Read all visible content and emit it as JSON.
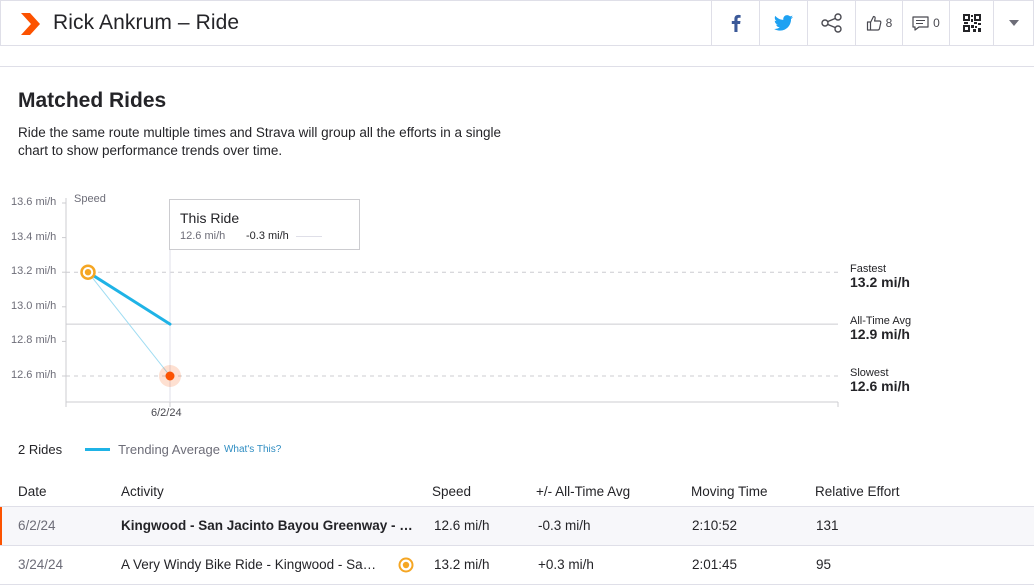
{
  "header": {
    "title": "Rick Ankrum – Ride",
    "kudos_count": "8",
    "comments_count": "0"
  },
  "icons": {
    "logo": "strava-chevron-icon",
    "facebook": "facebook-icon",
    "twitter": "twitter-icon",
    "share": "share-icon",
    "kudos": "thumbs-up-icon",
    "comments": "comment-icon",
    "qr": "qr-code-icon",
    "dropdown": "chevron-down-icon",
    "pr": "achievement-ring-icon"
  },
  "colors": {
    "accent": "#fc5200",
    "trend": "#1fb3e6",
    "achievement": "#f5a623",
    "facebook": "#3b5998",
    "twitter": "#1da1f2"
  },
  "section": {
    "title": "Matched Rides",
    "description": "Ride the same route multiple times and Strava will group all the efforts in a single chart to show performance trends over time."
  },
  "chart_data": {
    "type": "scatter",
    "ylabel": "Speed",
    "y_unit": "mi/h",
    "ylim": [
      12.5,
      13.6
    ],
    "yticks": [
      "13.6 mi/h",
      "13.4 mi/h",
      "13.2 mi/h",
      "13.0 mi/h",
      "12.8 mi/h",
      "12.6 mi/h"
    ],
    "ytick_values": [
      13.6,
      13.4,
      13.2,
      13.0,
      12.8,
      12.6
    ],
    "xtick_labels": [
      "6/2/24"
    ],
    "points": [
      {
        "date": "3/24/24",
        "speed": 13.2,
        "kind": "fastest"
      },
      {
        "date": "6/2/24",
        "speed": 12.6,
        "kind": "selected"
      }
    ],
    "trend_line": [
      {
        "date": "3/24/24",
        "speed": 13.2
      },
      {
        "date": "6/2/24",
        "speed": 12.9
      }
    ],
    "reference_lines": [
      {
        "label": "Fastest",
        "value_text": "13.2 mi/h",
        "value": 13.2
      },
      {
        "label": "All-Time Avg",
        "value_text": "12.9 mi/h",
        "value": 12.9
      },
      {
        "label": "Slowest",
        "value_text": "12.6 mi/h",
        "value": 12.6
      }
    ],
    "tooltip": {
      "title": "This Ride",
      "speed": "12.6 mi/h",
      "diff": "-0.3 mi/h"
    }
  },
  "legend": {
    "rides": "2 Rides",
    "trend": "Trending Average",
    "whats_this": "What's This?"
  },
  "table": {
    "headers": [
      "Date",
      "Activity",
      "Speed",
      "+/- All-Time Avg",
      "Moving Time",
      "Relative Effort"
    ],
    "rows": [
      {
        "date": "6/2/24",
        "activity": "Kingwood - San Jacinto Bayou Greenway - O…",
        "speed": "12.6 mi/h",
        "diff": "-0.3 mi/h",
        "time": "2:10:52",
        "effort": "131"
      },
      {
        "date": "3/24/24",
        "activity": "A Very Windy Bike Ride - Kingwood - Sa…",
        "speed": "13.2 mi/h",
        "diff": "+0.3 mi/h",
        "time": "2:01:45",
        "effort": "95"
      }
    ]
  }
}
